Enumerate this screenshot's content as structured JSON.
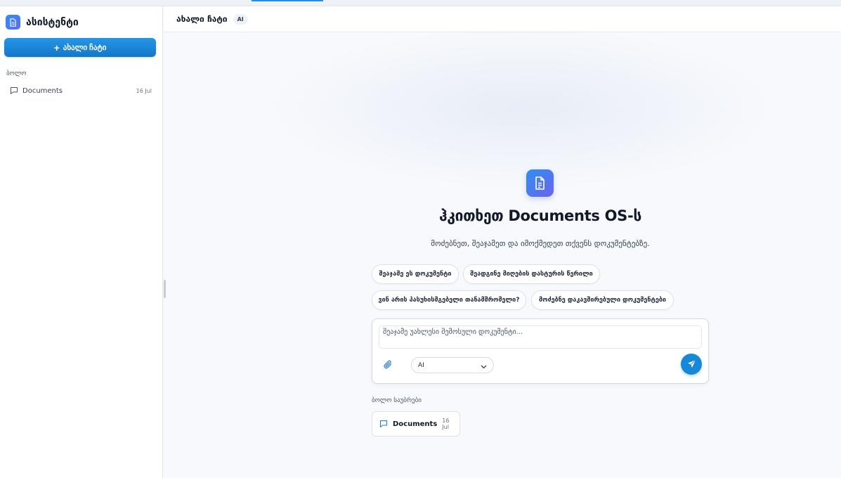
{
  "sidebar": {
    "title": "ასისტენტი",
    "new_chat_label": "ახალი ჩატი",
    "recent_label": "ბოლო",
    "items": [
      {
        "label": "Documents",
        "date": "16 Jul"
      }
    ]
  },
  "header": {
    "title": "ახალი ჩატი",
    "badge": "AI"
  },
  "hero": {
    "title": "ჰკითხეთ Documents OS-ს",
    "subtitle": "მოძებნეთ, შეაჯამეთ და იმოქმედეთ თქვენს დოკუმენტებზე."
  },
  "suggestions": [
    "შეაჯამე ეს დოკუმენტი",
    "შეადგინე მიღების დასტურის წერილი",
    "ვინ არის პასუხისმგებელი თანამშრომელი?",
    "მოძებნე დაკავშირებული დოკუმენტები"
  ],
  "composer": {
    "placeholder": "შეაჯამე უახლესი შემოსული დოკუმენტი...",
    "model_value": "AI"
  },
  "recent_conversations": {
    "label": "ბოლო საუბრები",
    "items": [
      {
        "label": "Documents",
        "date": "16 Jul"
      }
    ]
  },
  "colors": {
    "accent": "#1787d8",
    "brand_gradient_start": "#2f8ff0",
    "brand_gradient_end": "#6a64ee"
  },
  "icons": {
    "brand": "document-icon",
    "new_chat": "plus-icon",
    "chat_item": "chat-bubble-icon",
    "attach": "paperclip-icon",
    "dropdown": "chevron-down-icon",
    "send": "send-icon"
  }
}
